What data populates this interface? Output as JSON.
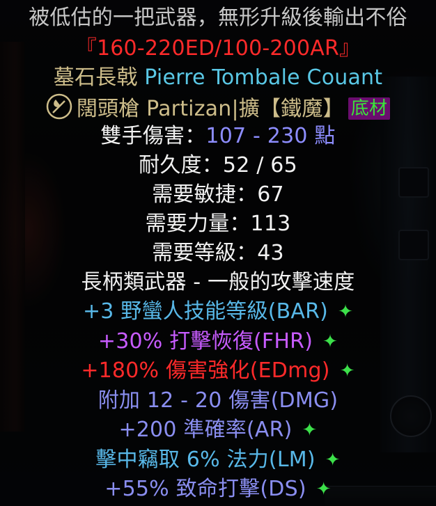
{
  "tooltip": {
    "flavor": "被低估的一把武器，無形升級後輸出不俗",
    "roll_range": "『160-220ED/100-200AR』",
    "elite_name": "墓石長戟 Pierre Tombale Couant",
    "base_name": "闊頭槍 Partizan|擴【鐵魔】",
    "base_badge": "底材",
    "two_hand_damage_label": "雙手傷害：",
    "two_hand_damage_value": "107 - 230 點",
    "durability": "耐久度：52 / 65",
    "req_dex": "需要敏捷：67",
    "req_str": "需要力量：113",
    "req_level": "需要等級：43",
    "weapon_class": "長柄類武器 - 一般的攻擊速度",
    "mods": [
      {
        "text": "+3 野蠻人技能等級(BAR)",
        "star": true,
        "color": "#58b8e8"
      },
      {
        "text": "+30% 打擊恢復(FHR)",
        "star": true,
        "color": "#c85cff"
      },
      {
        "text": "+180% 傷害強化(EDmg)",
        "star": true,
        "color": "#ff2a2a"
      },
      {
        "text": "附加 12 - 20 傷害(DMG)",
        "star": false,
        "color": "#8a8ef0"
      },
      {
        "text": "+200 準確率(AR)",
        "star": true,
        "color": "#8a8ef0"
      },
      {
        "text": "擊中竊取 6% 法力(LM)",
        "star": true,
        "color": "#58b8e8"
      },
      {
        "text": "+55% 致命打擊(DS)",
        "star": true,
        "color": "#8a8ef0"
      }
    ],
    "star_glyph": "✦"
  }
}
